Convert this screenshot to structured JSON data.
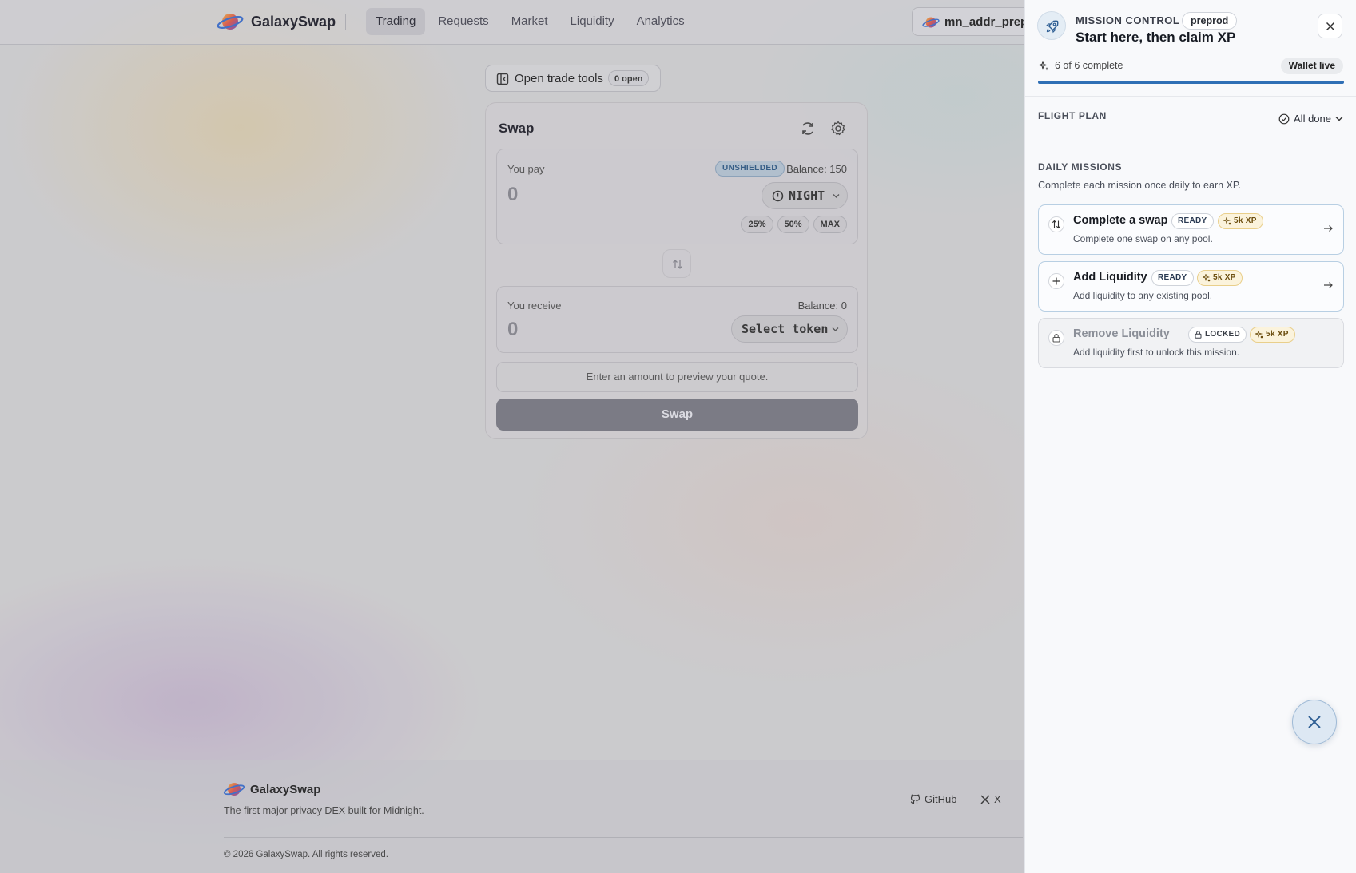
{
  "header": {
    "brand": "GalaxySwap",
    "nav": [
      {
        "label": "Trading",
        "active": true
      },
      {
        "label": "Requests",
        "active": false
      },
      {
        "label": "Market",
        "active": false
      },
      {
        "label": "Liquidity",
        "active": false
      },
      {
        "label": "Analytics",
        "active": false
      }
    ],
    "wallet_address": "mn_addr_prepr"
  },
  "trade_tools": {
    "label": "Open trade tools",
    "badge": "0 open"
  },
  "swap": {
    "title": "Swap",
    "refresh_icon": "refresh-icon",
    "settings_icon": "gear-icon",
    "pay": {
      "label": "You pay",
      "badge": "UNSHIELDED",
      "balance": "Balance: 150",
      "amount_placeholder": "0",
      "token": "NIGHT",
      "percent_buttons": [
        "25%",
        "50%",
        "MAX"
      ]
    },
    "receive": {
      "label": "You receive",
      "balance": "Balance: 0",
      "amount_placeholder": "0",
      "token": "Select token"
    },
    "quote_hint": "Enter an amount to preview your quote.",
    "submit_label": "Swap"
  },
  "footer": {
    "brand": "GalaxySwap",
    "tagline": "The first major privacy DEX built for Midnight.",
    "links": [
      {
        "label": "GitHub",
        "icon": "github-icon"
      },
      {
        "label": "X",
        "icon": "x-logo-icon"
      }
    ],
    "copyright": "© 2026 GalaxySwap. All rights reserved."
  },
  "panel": {
    "eyebrow": "MISSION CONTROL",
    "env_badge": "preprod",
    "title": "Start here, then claim XP",
    "progress_text": "6 of 6 complete",
    "progress_fraction": 1.0,
    "wallet_status": "Wallet live",
    "flight_plan": {
      "heading": "FLIGHT PLAN",
      "status": "All done"
    },
    "daily": {
      "heading": "DAILY MISSIONS",
      "subtitle": "Complete each mission once daily to earn XP.",
      "missions": [
        {
          "title": "Complete a swap",
          "status": "READY",
          "xp": "5k XP",
          "desc": "Complete one swap on any pool.",
          "icon": "swap-vertical-icon",
          "locked": false
        },
        {
          "title": "Add Liquidity",
          "status": "READY",
          "xp": "5k XP",
          "desc": "Add liquidity to any existing pool.",
          "icon": "plus-icon",
          "locked": false
        },
        {
          "title": "Remove Liquidity",
          "status": "LOCKED",
          "xp": "5k XP",
          "desc": "Add liquidity first to unlock this mission.",
          "icon": "lock-icon",
          "locked": true
        }
      ]
    }
  },
  "colors": {
    "accent": "#2f6fb5",
    "xp_chip": "#fbf3dc",
    "swap_button": "#7b7b86"
  }
}
